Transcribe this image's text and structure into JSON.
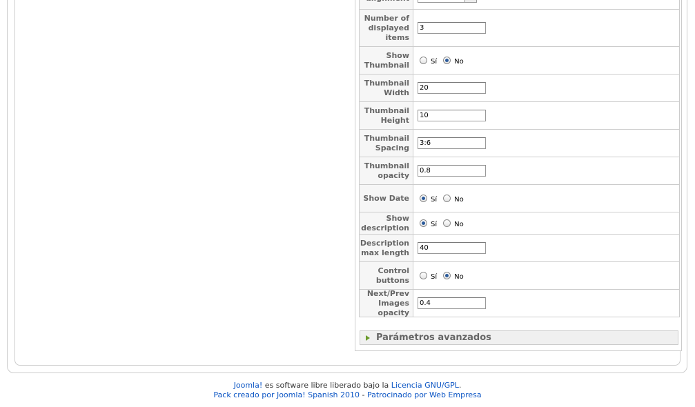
{
  "params": {
    "rows": [
      {
        "id": "alignment",
        "label_lines": [
          "alignment"
        ],
        "type": "select"
      },
      {
        "id": "number-of-displayed-items",
        "label_lines": [
          "Number of",
          "displayed",
          "items"
        ],
        "type": "text",
        "value": "3"
      },
      {
        "id": "show-thumbnail",
        "label_lines": [
          "Show",
          "Thumbnail"
        ],
        "type": "radio",
        "selected": "No",
        "options": [
          "Sí",
          "No"
        ]
      },
      {
        "id": "thumbnail-width",
        "label_lines": [
          "Thumbnail",
          "Width"
        ],
        "type": "text",
        "value": "20"
      },
      {
        "id": "thumbnail-height",
        "label_lines": [
          "Thumbnail",
          "Height"
        ],
        "type": "text",
        "value": "10"
      },
      {
        "id": "thumbnail-spacing",
        "label_lines": [
          "Thumbnail",
          "Spacing"
        ],
        "type": "text",
        "value": "3:6"
      },
      {
        "id": "thumbnail-opacity",
        "label_lines": [
          "Thumbnail",
          "opacity"
        ],
        "type": "text",
        "value": "0.8"
      },
      {
        "id": "show-date",
        "label_lines": [
          "Show Date"
        ],
        "type": "radio",
        "selected": "Sí",
        "options": [
          "Sí",
          "No"
        ]
      },
      {
        "id": "show-description",
        "label_lines": [
          "Show",
          "description"
        ],
        "type": "radio",
        "selected": "Sí",
        "options": [
          "Sí",
          "No"
        ]
      },
      {
        "id": "description-max-length",
        "label_lines": [
          "Description",
          "max length"
        ],
        "type": "text",
        "value": "40"
      },
      {
        "id": "control-buttons",
        "label_lines": [
          "Control",
          "buttons"
        ],
        "type": "radio",
        "selected": "No",
        "options": [
          "Sí",
          "No"
        ]
      },
      {
        "id": "next-prev-images-opacity",
        "label_lines": [
          "Next/Prev",
          "Images",
          "opacity"
        ],
        "type": "text",
        "value": "0.4"
      }
    ]
  },
  "advanced": {
    "label": "Parámetros avanzados",
    "icon": "triangle-right-icon"
  },
  "footer": {
    "line1": {
      "joomla_link": "Joomla!",
      "text": " es software libre liberado bajo la ",
      "license_link": "Licencia GNU/GPL",
      "end": "."
    },
    "line2": {
      "pack_link": "Pack creado por Joomla! Spanish 2010",
      "sep": " - ",
      "sponsor_link": "Patrocinado por Web Empresa"
    }
  },
  "colors": {
    "link": "#0b55c4",
    "label": "#666666",
    "border": "#cccccc",
    "radio_dot": "#2a5a9a",
    "arrow": "#6a9a2a"
  }
}
